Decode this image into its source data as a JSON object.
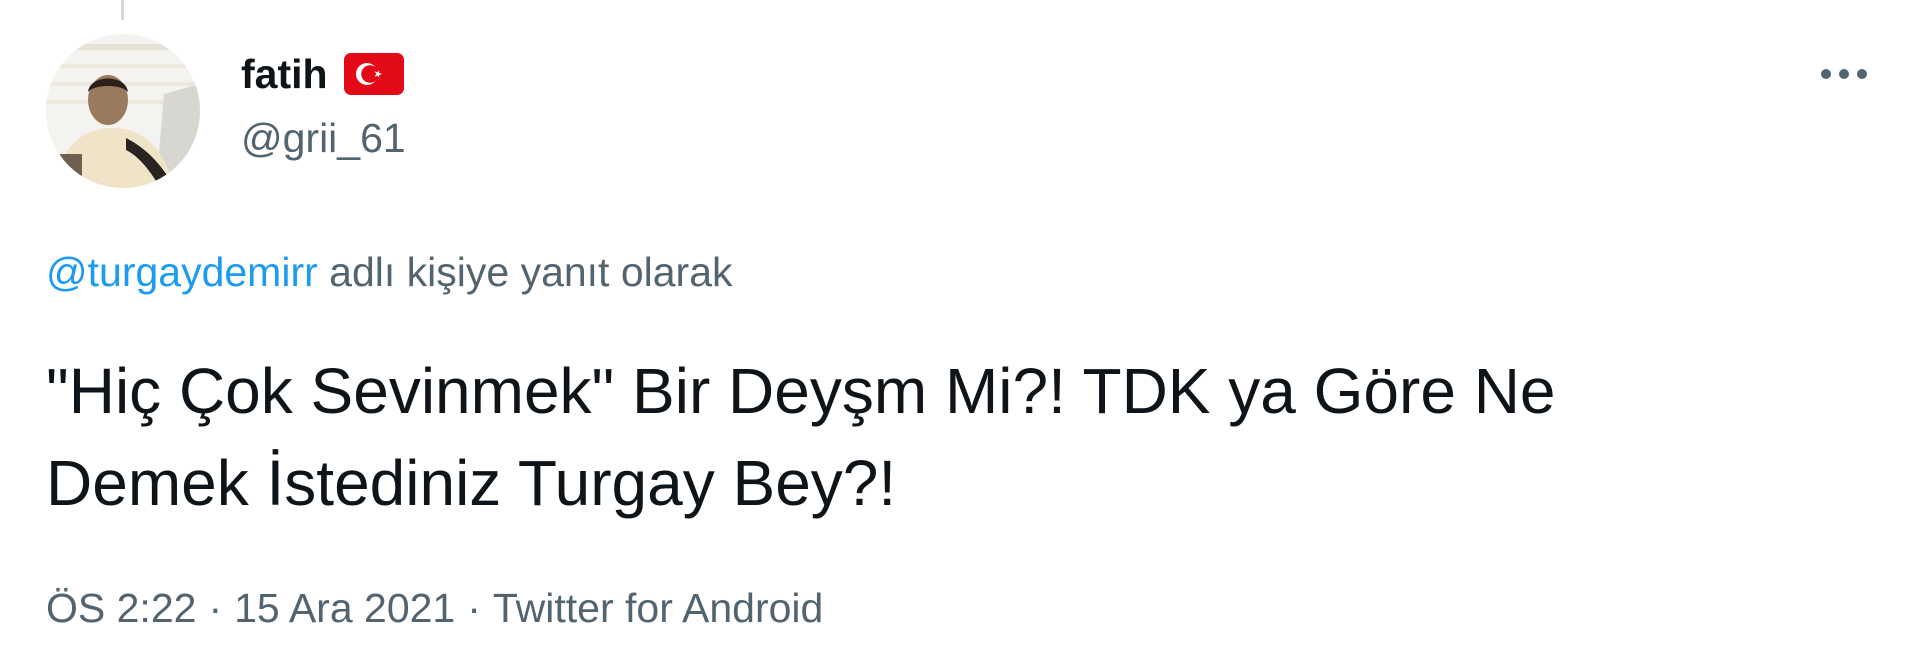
{
  "tweet": {
    "author": {
      "display_name": "fatih",
      "flag_icon": "turkey-flag-icon",
      "handle": "@grii_61"
    },
    "reply_context": {
      "mention": "@turgaydemirr",
      "suffix": "adlı kişiye yanıt olarak"
    },
    "text_line1": "\"Hiç Çok Sevinmek\" Bir Deyşm Mi?! TDK ya Göre Ne",
    "text_line2": "Demek İstediniz Turgay Bey?!",
    "meta": {
      "time": "ÖS 2:22",
      "separator": "·",
      "date": "15 Ara 2021",
      "source": "Twitter for Android"
    },
    "more_icon": "more-horizontal-icon"
  },
  "colors": {
    "text_primary": "#0f1419",
    "text_secondary": "#536471",
    "link": "#1d9bf0",
    "flag_red": "#e30a17"
  }
}
